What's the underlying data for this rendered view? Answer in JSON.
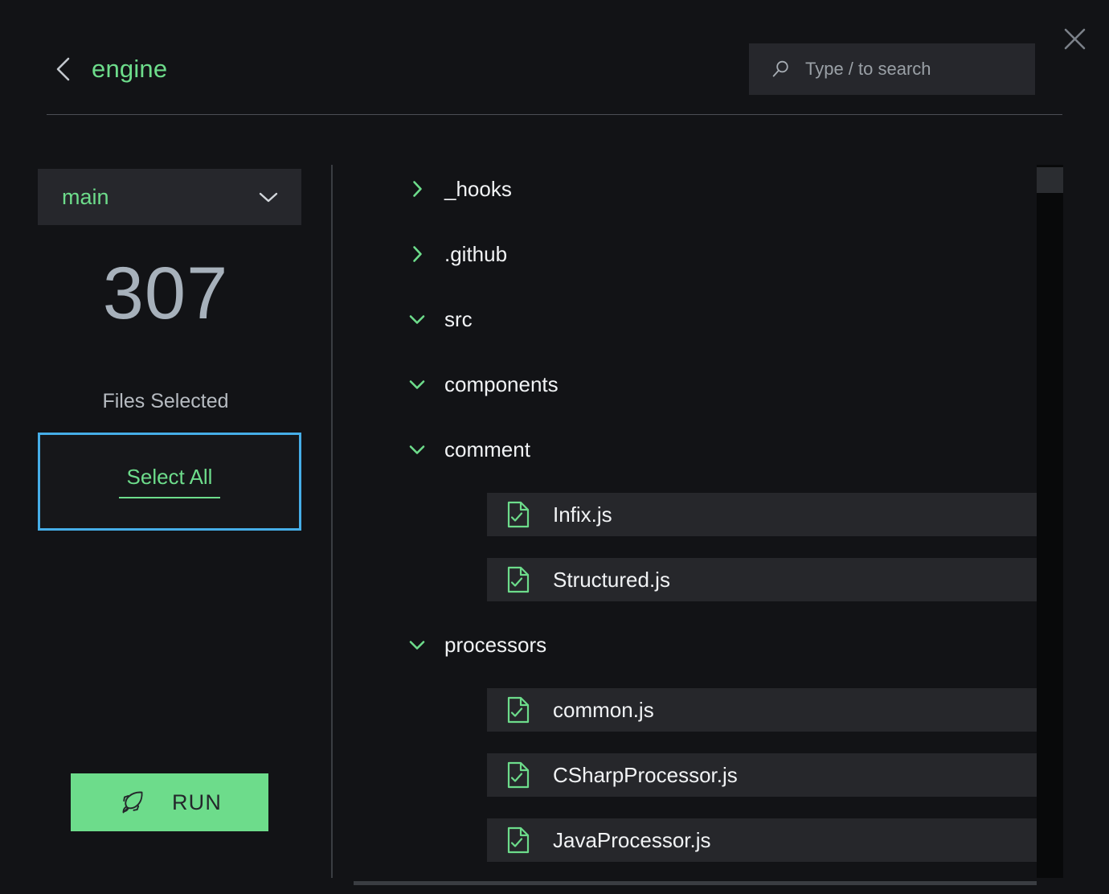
{
  "header": {
    "back_icon": "chevron-left-icon",
    "title": "engine",
    "search": {
      "icon": "search-icon",
      "placeholder": "Type / to search",
      "value": ""
    },
    "close_icon": "close-icon"
  },
  "sidebar": {
    "branch": {
      "label": "main",
      "chevron_icon": "chevron-down-icon"
    },
    "count": "307",
    "count_label": "Files Selected",
    "select_all_label": "Select All",
    "run_label": "RUN",
    "run_icon": "rocket-icon",
    "colors": {
      "accent_green": "#6ddc8b",
      "focus_blue": "#46aee8",
      "count_gray": "#a7b1bb",
      "panel": "#26272c",
      "background": "#121316"
    }
  },
  "tree": {
    "rows": [
      {
        "label": "_hooks",
        "type": "folder",
        "depth": 0,
        "expanded": false,
        "icon": "chevron-right-icon",
        "selected": false
      },
      {
        "label": ".github",
        "type": "folder",
        "depth": 0,
        "expanded": false,
        "icon": "chevron-right-icon",
        "selected": false
      },
      {
        "label": "src",
        "type": "folder",
        "depth": 0,
        "expanded": true,
        "icon": "chevron-down-icon",
        "selected": false
      },
      {
        "label": "components",
        "type": "folder",
        "depth": 1,
        "expanded": true,
        "icon": "chevron-down-icon",
        "selected": false
      },
      {
        "label": "comment",
        "type": "folder",
        "depth": 2,
        "expanded": true,
        "icon": "chevron-down-icon",
        "selected": false
      },
      {
        "label": "Infix.js",
        "type": "file",
        "depth": 3,
        "icon": "file-check-icon",
        "selected": true
      },
      {
        "label": "Structured.js",
        "type": "file",
        "depth": 3,
        "icon": "file-check-icon",
        "selected": true
      },
      {
        "label": "processors",
        "type": "folder",
        "depth": 2,
        "expanded": true,
        "icon": "chevron-down-icon",
        "selected": false
      },
      {
        "label": "common.js",
        "type": "file",
        "depth": 3,
        "icon": "file-check-icon",
        "selected": true
      },
      {
        "label": "CSharpProcessor.js",
        "type": "file",
        "depth": 3,
        "icon": "file-check-icon",
        "selected": true
      },
      {
        "label": "JavaProcessor.js",
        "type": "file",
        "depth": 3,
        "icon": "file-check-icon",
        "selected": true
      }
    ],
    "scrollbar": {
      "vertical_position": "top",
      "horizontal_visible": true
    }
  }
}
